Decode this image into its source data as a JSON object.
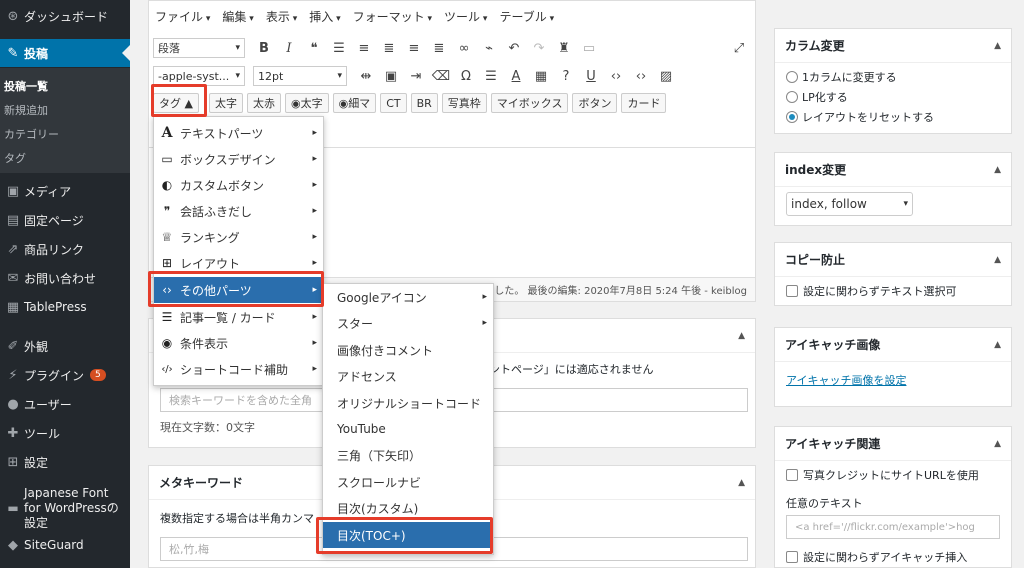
{
  "sidebar": {
    "items": [
      {
        "label": "ダッシュボード",
        "icon": "dashboard-icon",
        "glyph": "⊛"
      },
      {
        "label": "投稿",
        "icon": "pin-icon",
        "glyph": "✎"
      },
      {
        "label": "メディア",
        "icon": "media-icon",
        "glyph": "▣"
      },
      {
        "label": "固定ページ",
        "icon": "page-icon",
        "glyph": "▤"
      },
      {
        "label": "商品リンク",
        "icon": "share-icon",
        "glyph": "⇗"
      },
      {
        "label": "お問い合わせ",
        "icon": "mail-icon",
        "glyph": "✉"
      },
      {
        "label": "TablePress",
        "icon": "table-icon",
        "glyph": "▦"
      },
      {
        "label": "外観",
        "icon": "brush-icon",
        "glyph": "✐"
      },
      {
        "label": "プラグイン",
        "icon": "plugin-icon",
        "glyph": "⚡",
        "badge": "5"
      },
      {
        "label": "ユーザー",
        "icon": "user-icon",
        "glyph": "●"
      },
      {
        "label": "ツール",
        "icon": "wrench-icon",
        "glyph": "✚"
      },
      {
        "label": "設定",
        "icon": "settings-icon",
        "glyph": "⊞"
      },
      {
        "label": "Japanese Font for WordPressの設定",
        "icon": "font-icon",
        "glyph": "▬"
      },
      {
        "label": "SiteGuard",
        "icon": "shield-icon",
        "glyph": "◆"
      }
    ],
    "submenu": [
      "投稿一覧",
      "新規追加",
      "カテゴリー",
      "タグ"
    ]
  },
  "editor": {
    "menubar": [
      "ファイル",
      "編集",
      "表示",
      "挿入",
      "フォーマット",
      "ツール",
      "テーブル"
    ],
    "format_select": "段落",
    "font_select": "-apple-syst...",
    "size_select": "12pt",
    "buttons": [
      "タグ ▲",
      "太字",
      "太赤",
      "太字",
      "細マ",
      "CT",
      "BR",
      "写真枠",
      "マイボックス",
      "ボタン",
      "カード"
    ],
    "status": "した。 最後の編集: 2020年7月8日 5:24 午後 - keiblog"
  },
  "tag_menu": {
    "items": [
      {
        "label": "テキストパーツ",
        "glyph": "A",
        "icon": "text-icon"
      },
      {
        "label": "ボックスデザイン",
        "glyph": "▭",
        "icon": "inbox-icon"
      },
      {
        "label": "カスタムボタン",
        "glyph": "◐",
        "icon": "toggle-icon"
      },
      {
        "label": "会話ふきだし",
        "glyph": "❞",
        "icon": "speech-icon"
      },
      {
        "label": "ランキング",
        "glyph": "♕",
        "icon": "crown-icon"
      },
      {
        "label": "レイアウト",
        "glyph": "⊞",
        "icon": "grid-icon"
      },
      {
        "label": "その他パーツ",
        "glyph": "‹›",
        "icon": "code-icon"
      },
      {
        "label": "記事一覧 / カード",
        "glyph": "☰",
        "icon": "list-icon"
      },
      {
        "label": "条件表示",
        "glyph": "◉",
        "icon": "eye-icon"
      },
      {
        "label": "ショートコード補助",
        "glyph": "‹/›",
        "icon": "shortcode-icon"
      }
    ]
  },
  "sub_menu": {
    "items": [
      "Googleアイコン",
      "スター",
      "画像付きコメント",
      "アドセンス",
      "オリジナルショートコード",
      "YouTube",
      "三角（下矢印）",
      "スクロールナビ",
      "目次(カスタム)",
      "目次(TOC+)"
    ]
  },
  "desc_box": {
    "note": "ントページ」には適応されません",
    "placeholder": "検索キーワードを含めた全角",
    "count": "現在文字数：0文字"
  },
  "meta_keyword": {
    "title": "メタキーワード",
    "hint": "複数指定する場合は半角カンマ",
    "placeholder": "松,竹,梅"
  },
  "right": {
    "column": {
      "title": "カラム変更",
      "options": [
        "1カラムに変更する",
        "LP化する",
        "レイアウトをリセットする"
      ],
      "selected": 2
    },
    "index": {
      "title": "index変更",
      "value": "index, follow"
    },
    "copy": {
      "title": "コピー防止",
      "checkbox": "設定に関わらずテキスト選択可"
    },
    "eyecatch": {
      "title": "アイキャッチ画像",
      "link": "アイキャッチ画像を設定"
    },
    "eyecatch_rel": {
      "title": "アイキャッチ関連",
      "checkbox1": "写真クレジットにサイトURLを使用",
      "label": "任意のテキスト",
      "placeholder": "<a href='//flickr.com/example'>hog",
      "checkbox2": "設定に関わらずアイキャッチ挿入"
    }
  }
}
